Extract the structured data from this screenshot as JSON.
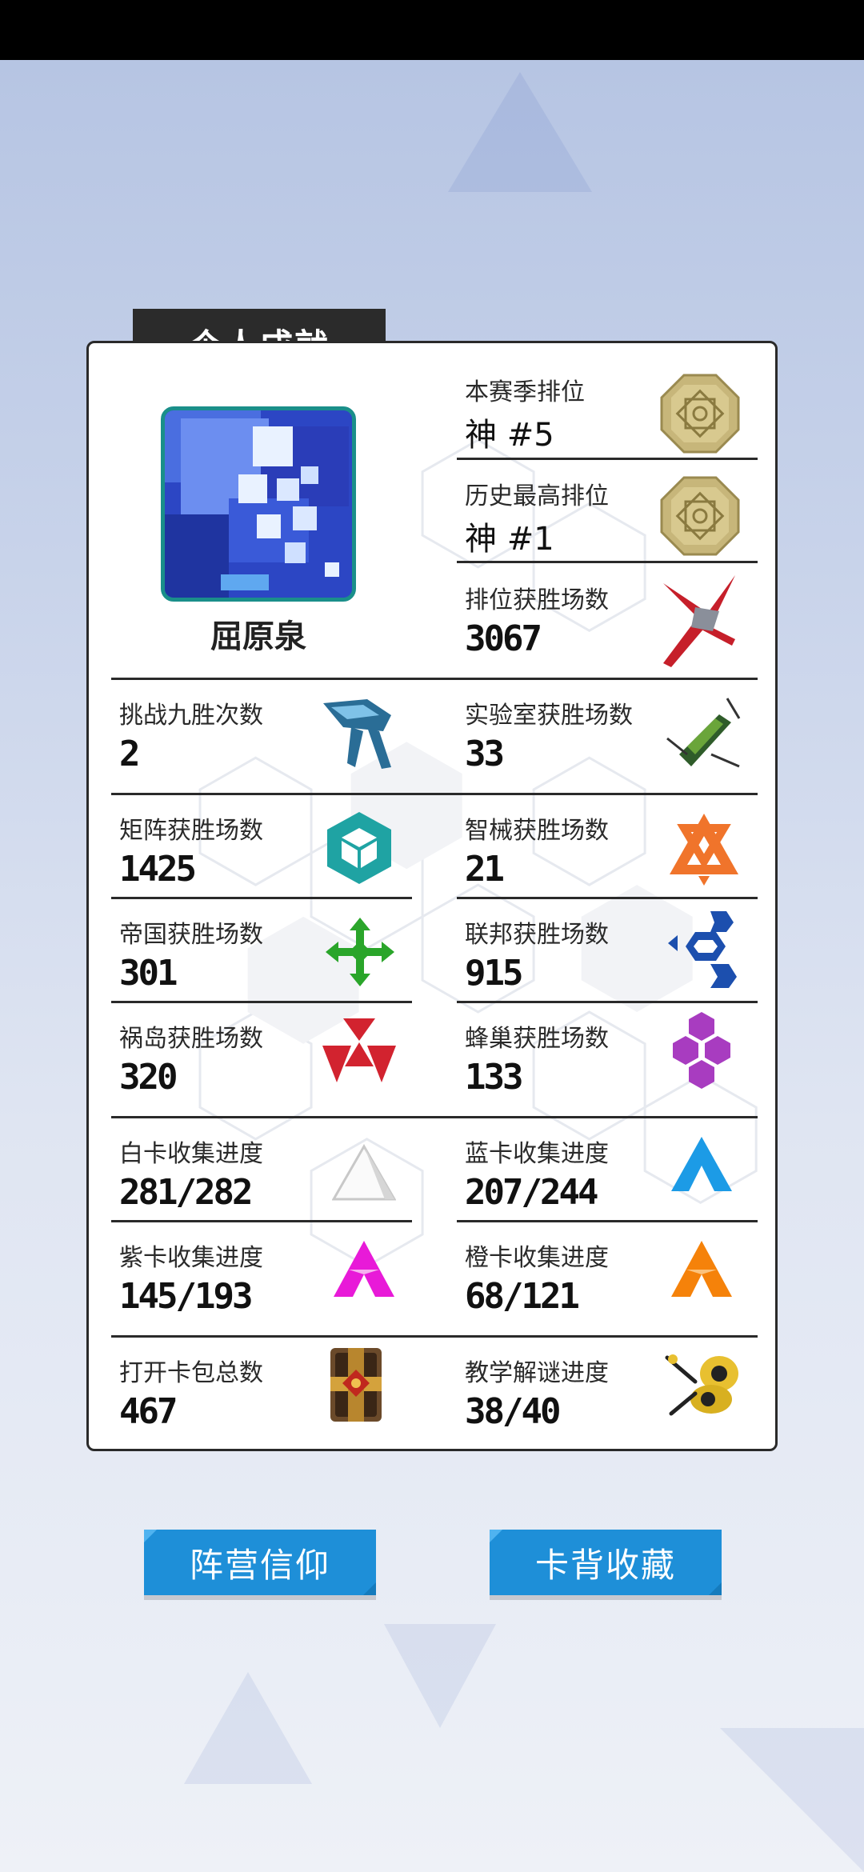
{
  "profile": {
    "section_title": "个人成就",
    "username": "屈原泉"
  },
  "stats": {
    "season_rank": {
      "label": "本赛季排位",
      "value": "神 #5",
      "icon": "medal-icon"
    },
    "best_rank": {
      "label": "历史最高排位",
      "value": "神 #1",
      "icon": "medal-icon"
    },
    "ranked_wins": {
      "label": "排位获胜场数",
      "value": "3067",
      "icon": "red-ship-icon"
    },
    "nine_win_challenges": {
      "label": "挑战九胜次数",
      "value": "2",
      "icon": "blue-ship-icon"
    },
    "lab_wins": {
      "label": "实验室获胜场数",
      "value": "33",
      "icon": "green-ship-icon"
    },
    "matrix_wins": {
      "label": "矩阵获胜场数",
      "value": "1425",
      "icon": "matrix-cube-icon"
    },
    "mechanical_wins": {
      "label": "智械获胜场数",
      "value": "21",
      "icon": "mech-triangle-icon"
    },
    "empire_wins": {
      "label": "帝国获胜场数",
      "value": "301",
      "icon": "empire-cross-icon"
    },
    "federation_wins": {
      "label": "联邦获胜场数",
      "value": "915",
      "icon": "federation-hex-icon"
    },
    "calamity_wins": {
      "label": "祸岛获胜场数",
      "value": "320",
      "icon": "calamity-triangles-icon"
    },
    "hive_wins": {
      "label": "蜂巢获胜场数",
      "value": "133",
      "icon": "hive-hexagons-icon"
    },
    "white_cards": {
      "label": "白卡收集进度",
      "value": "281/282",
      "icon": "white-triangle-icon"
    },
    "blue_cards": {
      "label": "蓝卡收集进度",
      "value": "207/244",
      "icon": "blue-triangle-icon"
    },
    "purple_cards": {
      "label": "紫卡收集进度",
      "value": "145/193",
      "icon": "purple-triangle-icon"
    },
    "orange_cards": {
      "label": "橙卡收集进度",
      "value": "68/121",
      "icon": "orange-triangle-icon"
    },
    "packs_opened": {
      "label": "打开卡包总数",
      "value": "467",
      "icon": "card-pack-icon"
    },
    "tutorial_progress": {
      "label": "教学解谜进度",
      "value": "38/40",
      "icon": "puzzle-drone-icon"
    }
  },
  "buttons": {
    "faction_faith": "阵营信仰",
    "card_back_collection": "卡背收藏"
  },
  "colors": {
    "button_blue": "#1e8fd8",
    "matrix_teal": "#1fa3a3",
    "mech_orange": "#f0742b",
    "empire_green": "#2aa52a",
    "federation_blue": "#1c4fae",
    "calamity_red": "#d2232f",
    "hive_purple": "#a83cc0"
  }
}
